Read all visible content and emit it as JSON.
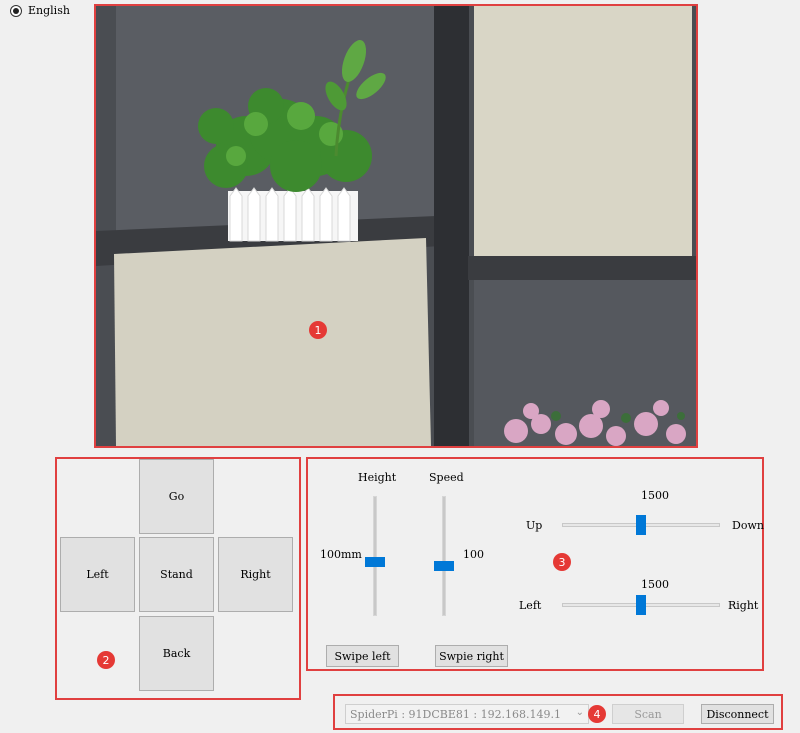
{
  "language": {
    "label": "English",
    "selected": true
  },
  "markers": [
    "1",
    "2",
    "3",
    "4"
  ],
  "pad": {
    "go": "Go",
    "left": "Left",
    "stand": "Stand",
    "right": "Right",
    "back": "Back"
  },
  "controls": {
    "height_label": "Height",
    "height_value": "100mm",
    "height_level": 0.45,
    "speed_label": "Speed",
    "speed_value": "100",
    "speed_level": 0.42,
    "slider1": {
      "value": "1500",
      "left_label": "Up",
      "right_label": "Down",
      "position": 0.5
    },
    "slider2": {
      "value": "1500",
      "left_label": "Left",
      "right_label": "Right",
      "position": 0.5
    },
    "swipe_left": "Swipe left",
    "swipe_right": "Swpie right"
  },
  "connection": {
    "device": "SpiderPi : 91DCBE81 : 192.168.149.1",
    "scan_label": "Scan",
    "disconnect_label": "Disconnect"
  },
  "colors": {
    "accent": "#0078d7",
    "annotation": "#e53935"
  }
}
